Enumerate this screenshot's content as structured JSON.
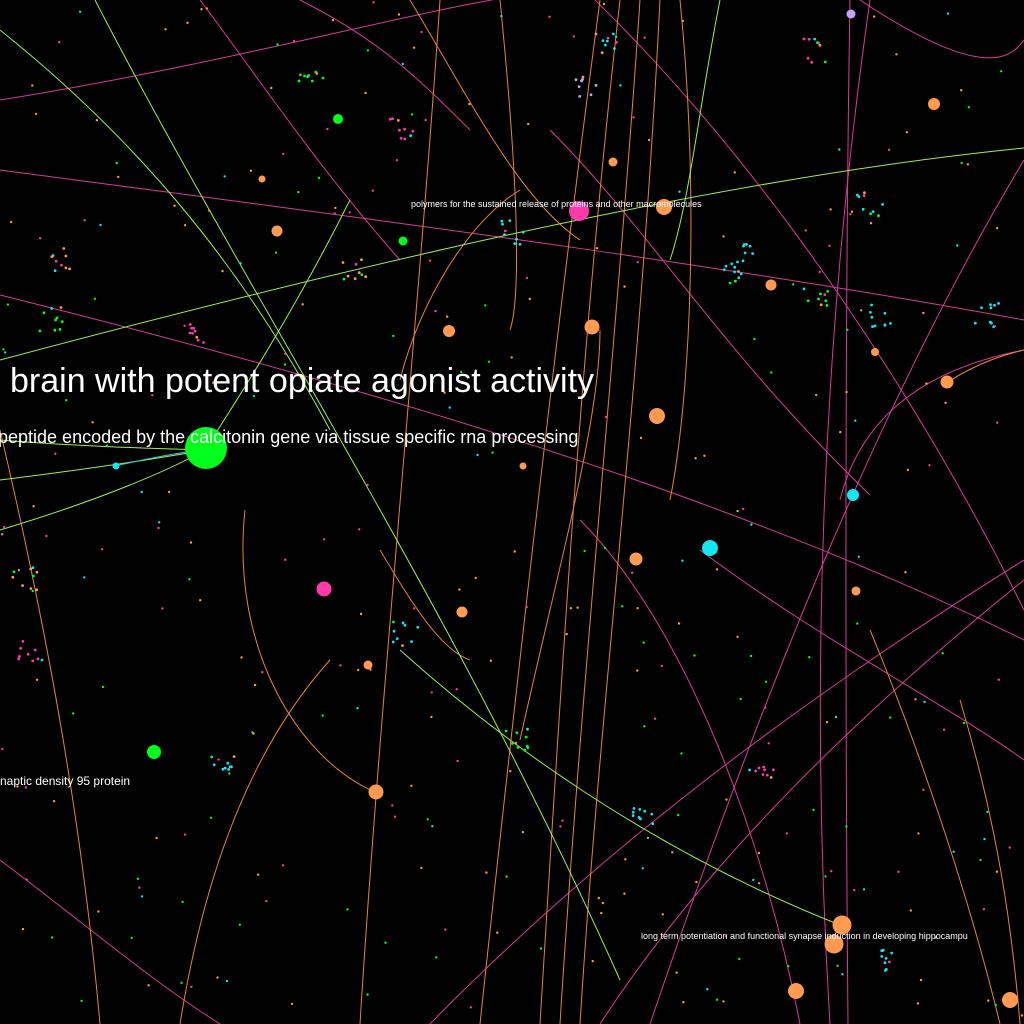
{
  "labels": {
    "opiate": "brain with potent opiate agonist activity",
    "calcitonin": "peptide encoded by the calcitonin gene via tissue specific rna processing",
    "polymers": "polymers for the sustained release of proteins and other macromolecules",
    "psd95": "naptic density 95 protein",
    "ltp": "long term potentiation and functional synapse induction in developing hippocampu"
  },
  "colors": {
    "background": "#000000",
    "green": "#00ff1a",
    "orange": "#ff9a50",
    "magenta": "#ff3aa8",
    "cyan": "#14e6f0",
    "lavender": "#c8a0ff",
    "edge_magenta": "#e0409a",
    "edge_orange": "#f08a40",
    "edge_lime": "#a8ff50"
  }
}
